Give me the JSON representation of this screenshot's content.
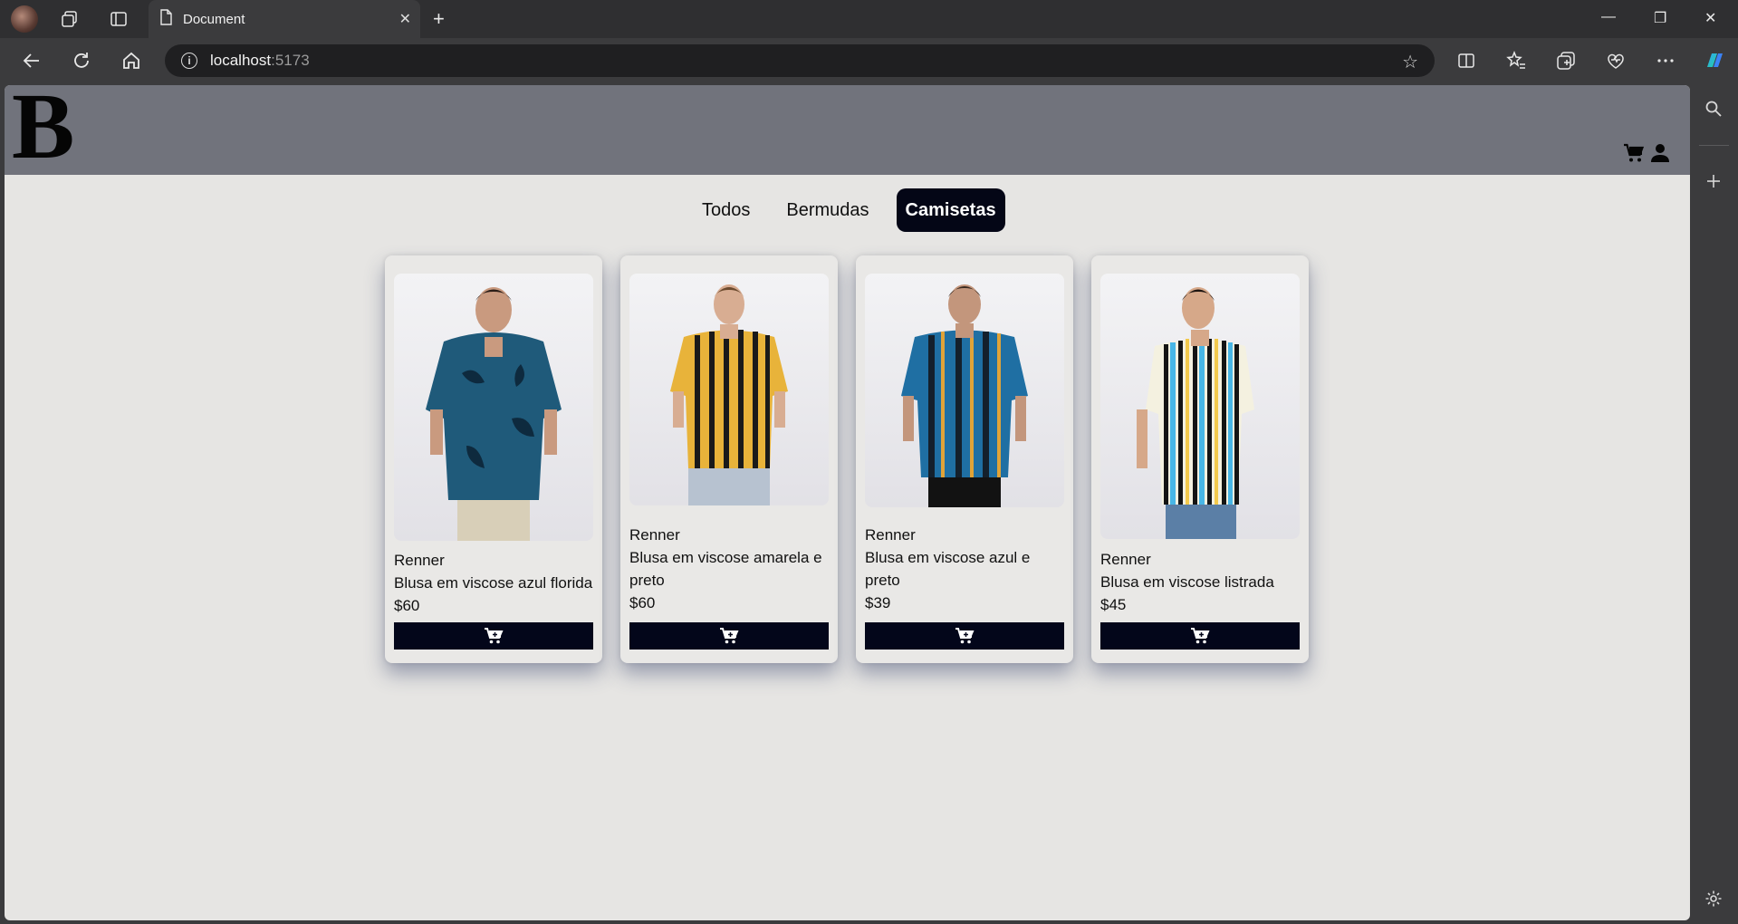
{
  "browser": {
    "tab_title": "Document",
    "url_host": "localhost",
    "url_port": ":5173"
  },
  "site": {
    "logo": "B",
    "filters": [
      {
        "label": "Todos",
        "active": false
      },
      {
        "label": "Bermudas",
        "active": false
      },
      {
        "label": "Camisetas",
        "active": true
      }
    ],
    "products": [
      {
        "brand": "Renner",
        "name": "Blusa em viscose azul florida",
        "price": "$60",
        "shirt_colors": [
          "#1f5a7a",
          "#0e2a3e"
        ],
        "image_icon": "blue-floral-shirt-photo"
      },
      {
        "brand": "Renner",
        "name": "Blusa em viscose amarela e preto",
        "price": "$60",
        "shirt_colors": [
          "#e8b33a",
          "#1a1a1a"
        ],
        "image_icon": "yellow-black-striped-shirt-photo"
      },
      {
        "brand": "Renner",
        "name": "Blusa em viscose azul e preto",
        "price": "$39",
        "shirt_colors": [
          "#1f6fa3",
          "#14202c"
        ],
        "image_icon": "blue-black-striped-shirt-photo"
      },
      {
        "brand": "Renner",
        "name": "Blusa em viscose listrada",
        "price": "$45",
        "shirt_colors": [
          "#48b6e6",
          "#141414"
        ],
        "image_icon": "multicolor-striped-shirt-photo"
      }
    ]
  },
  "colors": {
    "header_bg": "#71737c",
    "page_bg": "#e6e5e3",
    "accent_dark": "#040616"
  }
}
